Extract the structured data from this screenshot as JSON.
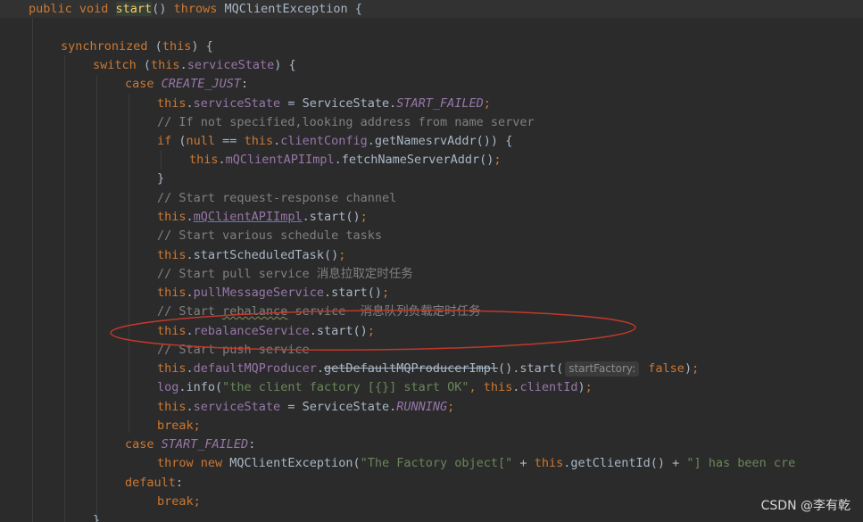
{
  "code": {
    "l0": {
      "kw1": "public void ",
      "name": "start",
      "paren": "() ",
      "kw2": "throws ",
      "rest": "MQClientException {"
    },
    "l2": {
      "kw": "synchronized ",
      "paren": "(",
      "this": "this",
      "rest": ") {"
    },
    "l3": {
      "kw": "switch ",
      "paren": "(",
      "this": "this",
      "dot": ".",
      "field": "serviceState",
      "rest": ") {"
    },
    "l4": {
      "kw": "case ",
      "const": "CREATE_JUST",
      "colon": ":"
    },
    "l5": {
      "this": "this",
      "dot": ".",
      "field": "serviceState",
      "mid": " = ServiceState.",
      "const": "START_FAILED",
      "semi": ";"
    },
    "l6": {
      "comment": "// If not specified,looking address from name server"
    },
    "l7": {
      "kw": "if ",
      "p1": "(",
      "null": "null",
      "mid": " == ",
      "this": "this",
      "dot": ".",
      "field": "clientConfig",
      "rest": ".getNamesrvAddr()) {"
    },
    "l8": {
      "this": "this",
      "dot": ".",
      "field": "mQClientAPIImpl",
      "rest": ".fetchNameServerAddr()",
      "semi": ";"
    },
    "l9": {
      "brace": "}"
    },
    "l10": {
      "comment": "// Start request-response channel"
    },
    "l11": {
      "this": "this",
      "dot": ".",
      "field": "mQClientAPIImpl",
      "rest": ".start()",
      "semi": ";"
    },
    "l12": {
      "comment": "// Start various schedule tasks"
    },
    "l13": {
      "this": "this",
      "rest": ".startScheduledTask()",
      "semi": ";"
    },
    "l14": {
      "comment": "// Start pull service ",
      "cn": "消息拉取定时任务"
    },
    "l15": {
      "this": "this",
      "dot": ".",
      "field": "pullMessageService",
      "rest": ".start()",
      "semi": ";"
    },
    "l16": {
      "c1": "// Start ",
      "c2": "rebalance",
      "c3": " service  ",
      "cn": "消息队列负载定时任务"
    },
    "l17": {
      "this": "this",
      "dot": ".",
      "field": "rebalanceService",
      "rest": ".start()",
      "semi": ";"
    },
    "l18": {
      "comment": "// Start push service"
    },
    "l19": {
      "this": "this",
      "dot": ".",
      "field": "defaultMQProducer",
      "dot2": ".",
      "strike": "getDefaultMQProducerImpl",
      "rest": "().start(",
      "hint": "startFactory:",
      "false": " false",
      "end": ")",
      "semi": ";"
    },
    "l20": {
      "obj": "log",
      "method": ".info(",
      "str": "\"the client factory [{}] start OK\"",
      "comma": ", ",
      "this": "this",
      "dot": ".",
      "field": "clientId",
      "end": ")",
      "semi": ";"
    },
    "l21": {
      "this": "this",
      "dot": ".",
      "field": "serviceState",
      "mid": " = ServiceState.",
      "const": "RUNNING",
      "semi": ";"
    },
    "l22": {
      "kw": "break",
      "semi": ";"
    },
    "l23": {
      "kw": "case ",
      "const": "START_FAILED",
      "colon": ":"
    },
    "l24": {
      "kw1": "throw ",
      "kw2": "new ",
      "cls": "MQClientException(",
      "str1": "\"The Factory object[\"",
      "plus": " + ",
      "this": "this",
      "rest": ".getClientId() + ",
      "str2": "\"] has been cre"
    },
    "l25": {
      "kw": "default",
      "colon": ":"
    },
    "l26": {
      "kw": "break",
      "semi": ";"
    },
    "l27": {
      "brace": "}"
    }
  },
  "watermark": "CSDN @李有乾",
  "colors": {
    "background": "#2b2b2b",
    "keyword": "#cc7832",
    "field": "#9876aa",
    "comment": "#808080",
    "string": "#6a8759",
    "method_decl": "#ffc66d",
    "annotation_ellipse": "#c0392b"
  }
}
